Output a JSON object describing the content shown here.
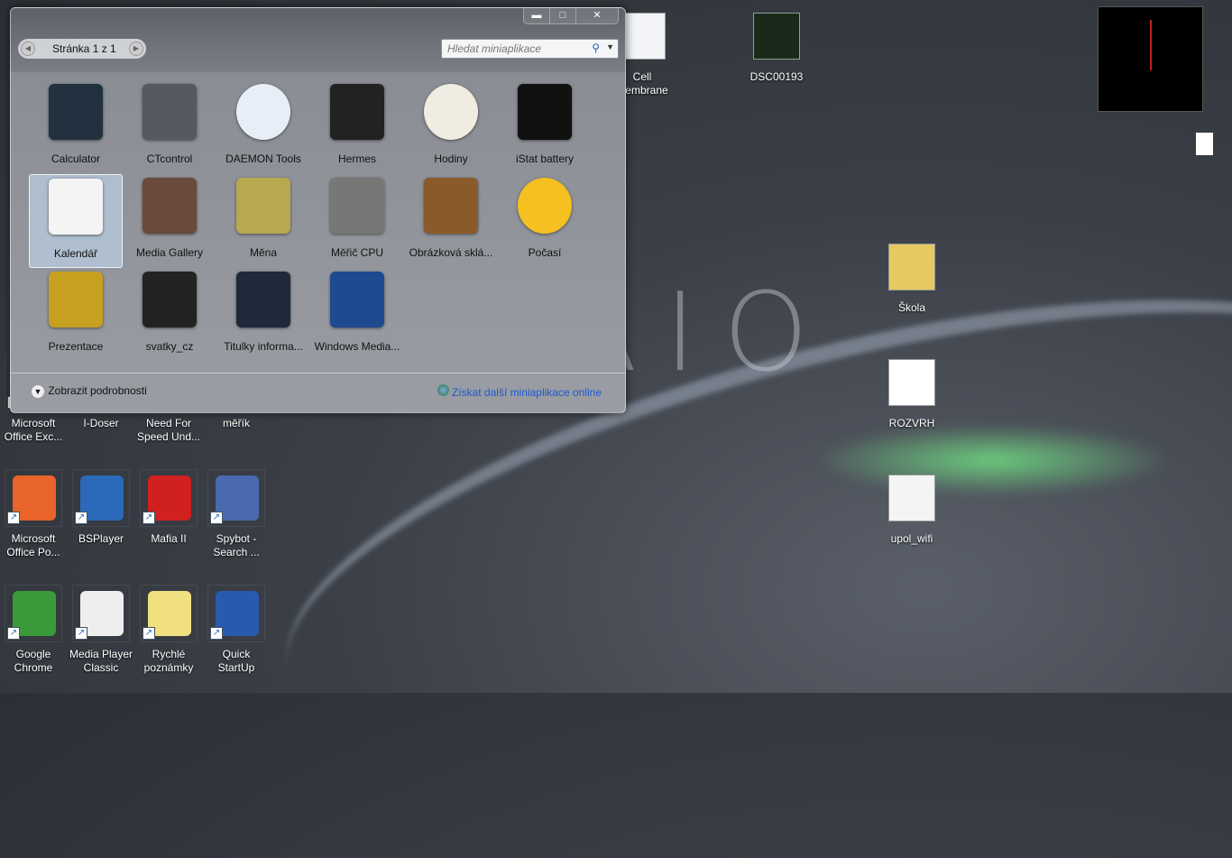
{
  "gadget_window": {
    "page_label": "Stránka 1 z 1",
    "search_placeholder": "Hledat miniaplikace",
    "gadgets": [
      {
        "label": "Calculator",
        "color": "#22313f"
      },
      {
        "label": "CTcontrol",
        "color": "#555a60"
      },
      {
        "label": "DAEMON Tools",
        "color": "#e8eef8"
      },
      {
        "label": "Hermes",
        "color": "#222"
      },
      {
        "label": "Hodiny",
        "color": "#f0ece2"
      },
      {
        "label": "iStat battery",
        "color": "#111"
      },
      {
        "label": "Kalendář",
        "color": "#f4f4f4"
      },
      {
        "label": "Media Gallery",
        "color": "#6a4a3a"
      },
      {
        "label": "Měna",
        "color": "#b8a850"
      },
      {
        "label": "Měřič CPU",
        "color": "#777"
      },
      {
        "label": "Obrázková sklá...",
        "color": "#8a5a2a"
      },
      {
        "label": "Počasí",
        "color": "#f5c020"
      },
      {
        "label": "Prezentace",
        "color": "#c8a020"
      },
      {
        "label": "svatky_cz",
        "color": "#222"
      },
      {
        "label": "Titulky informa...",
        "color": "#1e2a3a"
      },
      {
        "label": "Windows Media...",
        "color": "#1e4a90"
      }
    ],
    "details_label": "Zobrazit podrobnosti",
    "online_link": "Získat další miniaplikace online"
  },
  "desktop_icons": [
    {
      "label": "Microsoft Office Exc...",
      "color": "#2a7a3a"
    },
    {
      "label": "I-Doser",
      "color": "#3a8a3a"
    },
    {
      "label": "Need For Speed Und...",
      "color": "#333"
    },
    {
      "label": "měřík",
      "color": "#9a9a6a"
    },
    {
      "label": "Microsoft Office Po...",
      "color": "#e8642a"
    },
    {
      "label": "BSPlayer",
      "color": "#2a6ab8"
    },
    {
      "label": "Mafia II",
      "color": "#d02020"
    },
    {
      "label": "Spybot - Search ...",
      "color": "#4a6ab0"
    },
    {
      "label": "Google Chrome",
      "color": "#3a9a3a"
    },
    {
      "label": "Media Player Classic",
      "color": "#eee"
    },
    {
      "label": "Rychlé poznámky",
      "color": "#f0e080"
    },
    {
      "label": "Quick StartUp",
      "color": "#2a5ab0"
    }
  ],
  "right_icons": [
    {
      "label": "Cell membrane",
      "color": "#f2f4f8"
    },
    {
      "label": "DSC00193",
      "color": "#1a2a1a"
    },
    {
      "label": "Škola",
      "color": "#e8c860"
    },
    {
      "label": "ROZVRH",
      "color": "#fff"
    },
    {
      "label": "upol_wifi",
      "color": "#f4f4f4"
    }
  ],
  "brand": "VAIO"
}
